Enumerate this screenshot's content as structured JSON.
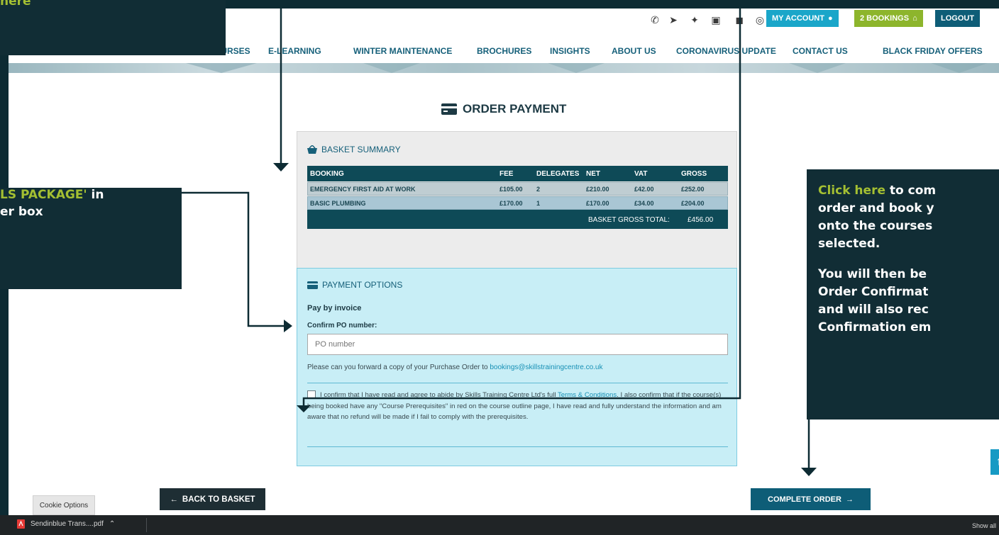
{
  "topbar": {
    "social_icons": [
      "phone-icon",
      "send-icon",
      "twitter-icon",
      "linkedin-icon",
      "facebook-icon",
      "instagram-icon"
    ],
    "my_account": "MY ACCOUNT",
    "bookings": "2 BOOKINGS",
    "logout": "LOGOUT",
    "my_account_color": "#1aa6c9",
    "bookings_color": "#8db52c",
    "logout_color": "#0e5d77"
  },
  "nav": [
    "OURSES",
    "E-LEARNING",
    "WINTER MAINTENANCE",
    "BROCHURES",
    "INSIGHTS",
    "ABOUT US",
    "CORONAVIRUS UPDATE",
    "CONTACT US",
    "BLACK FRIDAY OFFERS"
  ],
  "order_title": "ORDER PAYMENT",
  "basket": {
    "title": "BASKET SUMMARY",
    "headers": [
      "BOOKING",
      "FEE",
      "DELEGATES",
      "NET",
      "VAT",
      "GROSS"
    ],
    "rows": [
      [
        "EMERGENCY FIRST AID AT WORK",
        "£105.00",
        "2",
        "£210.00",
        "£42.00",
        "£252.00"
      ],
      [
        "BASIC PLUMBING",
        "£170.00",
        "1",
        "£170.00",
        "£34.00",
        "£204.00"
      ]
    ],
    "total_label": "BASKET GROSS TOTAL:",
    "total_value": "£456.00"
  },
  "payment": {
    "title": "PAYMENT OPTIONS",
    "method": "Pay by invoice",
    "po_label": "Confirm PO number:",
    "po_placeholder": "PO number",
    "po_note": "Please can you forward a copy of your Purchase Order to",
    "po_email": "bookings@skillstrainingcentre.co.uk",
    "terms_before": "I confirm that I have read and agree to abide by Skills Training Centre Ltd's full",
    "terms_link": "Terms & Conditions",
    "terms_after": ". I also confirm that if the course(s) being booked have any \"Course Prerequisites\" in red on the course outline page, I have read and fully understand the information and am aware that no refund will be made if I fail to comply with the prerequisites."
  },
  "buttons": {
    "back": "BACK TO BASKET",
    "complete": "COMPLETE ORDER",
    "cookie": "Cookie Options"
  },
  "downloads": {
    "file": "Sendinblue Trans....pdf",
    "show_all": "Show all"
  },
  "callouts": {
    "top": "here",
    "left": [
      "LS PACKAGE' in",
      "er box"
    ],
    "right_highlight": "Click here",
    "right_line1_rest": " to com",
    "right_lines": [
      "order and book y",
      "onto the courses",
      "selected.",
      "",
      "You will then be",
      "Order Confirmat",
      "and will also rec",
      "Confirmation em"
    ]
  },
  "colors": {
    "dark_teal": "#0e4a57",
    "accent_green": "#a4bf32",
    "callout_bg": "#112d35",
    "payment_bg": "#c8eef6"
  }
}
